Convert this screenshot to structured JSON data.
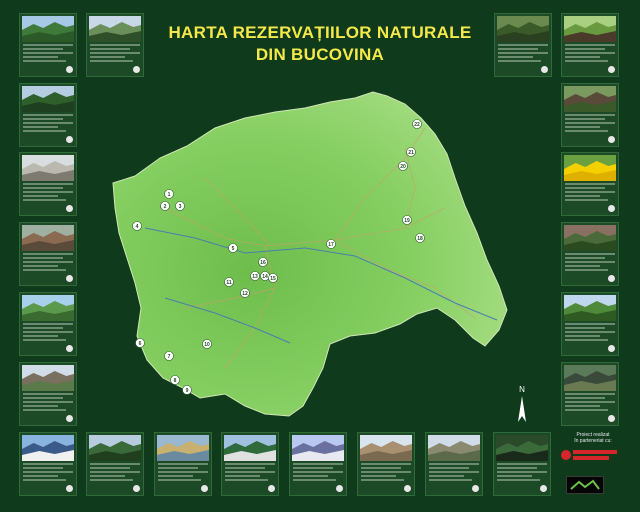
{
  "title": {
    "line1": "HARTA REZERVAȚIILOR NATURALE",
    "line2": "DIN BUCOVINA"
  },
  "compass": {
    "label": "N"
  },
  "partner": {
    "line1": "Proiect realizat",
    "line2": "în parteneriat cu:"
  },
  "colors": {
    "background": "#0f3a1c",
    "title": "#f5e94a",
    "map_fill": "#7ec95a",
    "river": "#4a7fb0",
    "marker": "#ffffff"
  },
  "markers": [
    {
      "n": "1"
    },
    {
      "n": "2"
    },
    {
      "n": "3"
    },
    {
      "n": "4"
    },
    {
      "n": "5"
    },
    {
      "n": "6"
    },
    {
      "n": "7"
    },
    {
      "n": "8"
    },
    {
      "n": "9"
    },
    {
      "n": "10"
    },
    {
      "n": "11"
    },
    {
      "n": "12"
    },
    {
      "n": "13"
    },
    {
      "n": "14"
    },
    {
      "n": "15"
    },
    {
      "n": "16"
    },
    {
      "n": "17"
    },
    {
      "n": "18"
    },
    {
      "n": "19"
    },
    {
      "n": "20"
    },
    {
      "n": "21"
    },
    {
      "n": "22"
    }
  ],
  "cards": [
    {
      "photo": "forest-meadow-photo"
    },
    {
      "photo": "mountain-forest-photo"
    },
    {
      "photo": "conifer-forest-photo"
    },
    {
      "photo": "rock-cliff-photo"
    },
    {
      "photo": "rocky-slope-photo"
    },
    {
      "photo": "river-valley-photo"
    },
    {
      "photo": "rock-formation-photo"
    },
    {
      "photo": "forest-trunks-photo"
    },
    {
      "photo": "beech-forest-photo"
    },
    {
      "photo": "tree-trunks-photo"
    },
    {
      "photo": "yellow-flowers-photo"
    },
    {
      "photo": "forest-clearing-photo"
    },
    {
      "photo": "hill-forest-photo"
    },
    {
      "photo": "rock-gorge-photo"
    },
    {
      "photo": "mountain-panorama-photo"
    },
    {
      "photo": "forest-edge-photo"
    },
    {
      "photo": "lake-photo"
    },
    {
      "photo": "hills-photo"
    },
    {
      "photo": "mountain-ridge-photo"
    },
    {
      "photo": "rock-towers-photo"
    },
    {
      "photo": "alpine-hill-photo"
    },
    {
      "photo": "dense-forest-photo"
    }
  ]
}
